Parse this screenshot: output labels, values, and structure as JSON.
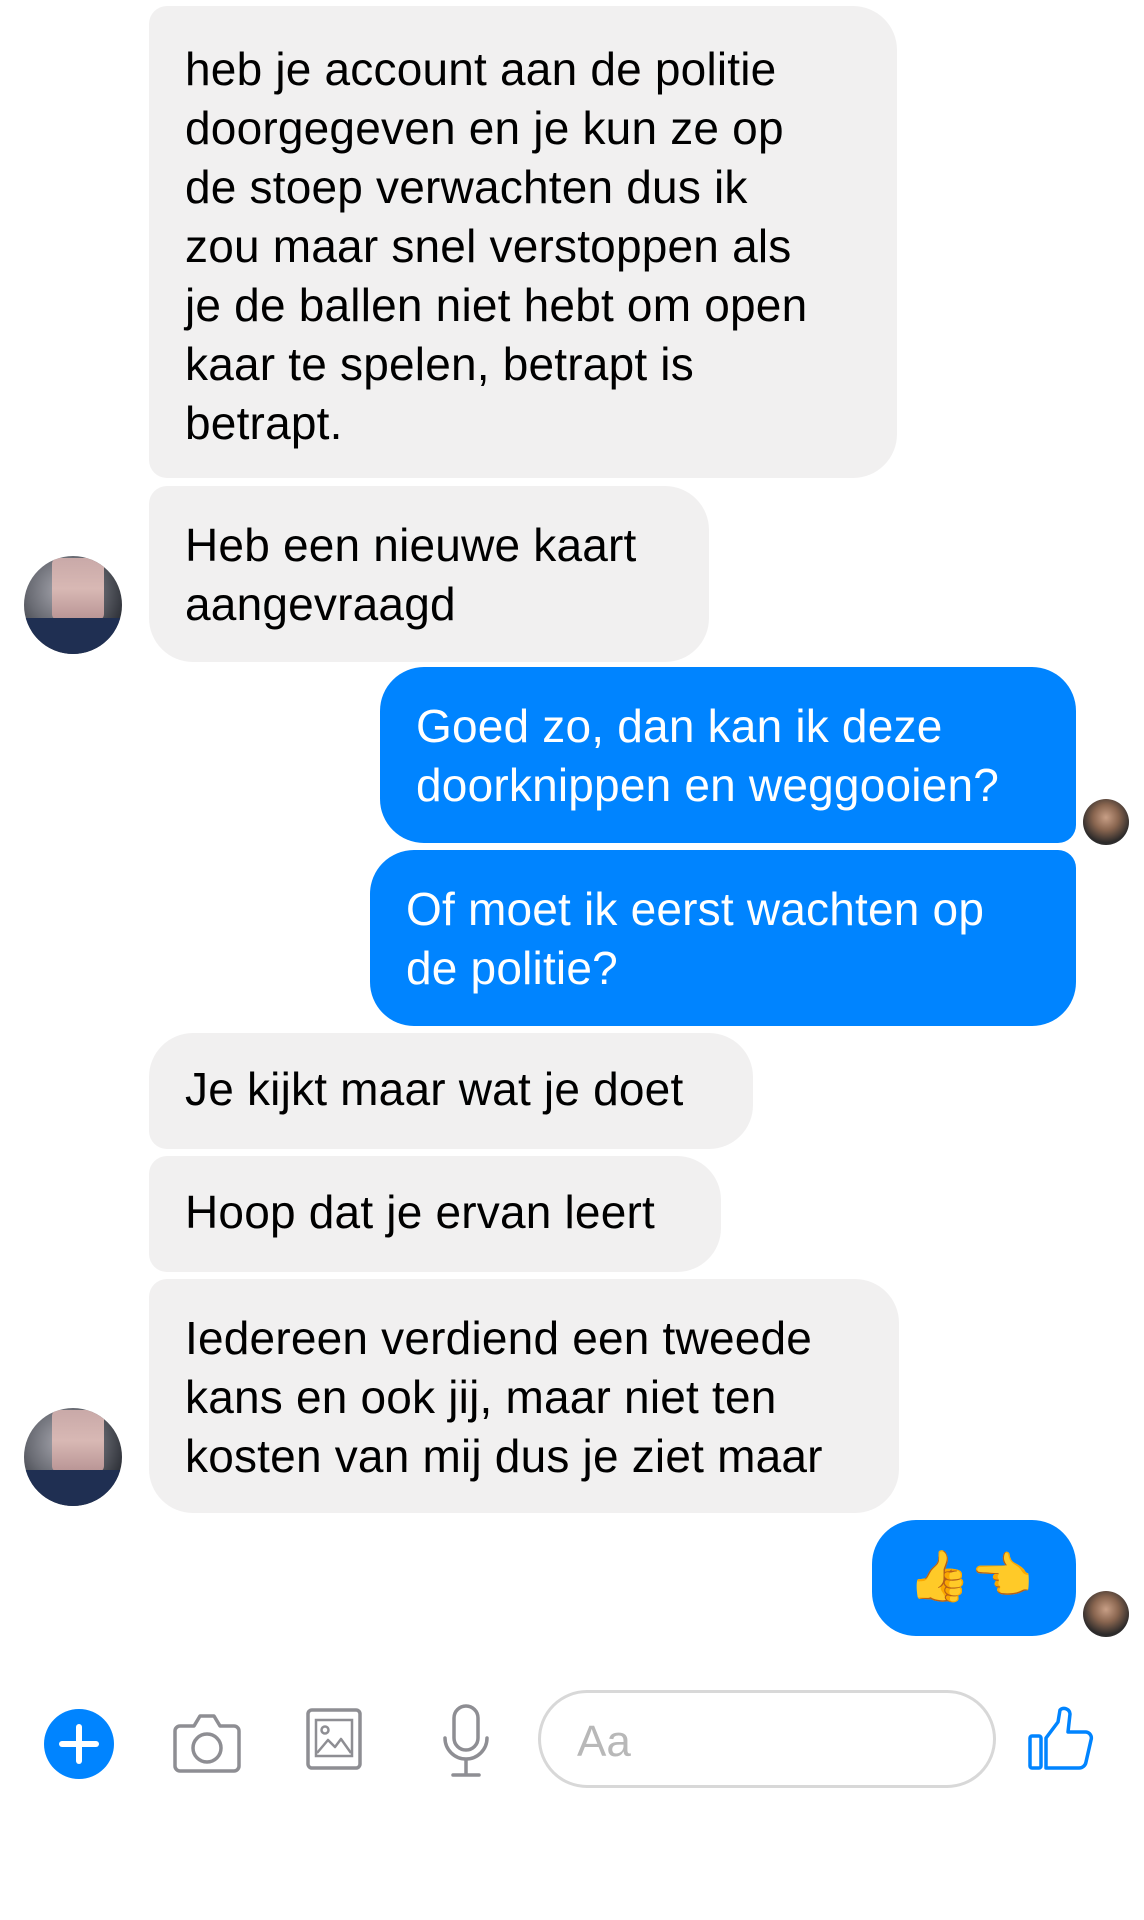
{
  "messages": [
    {
      "direction": "in",
      "text": "heb je account aan de politie\ndoorgegeven en je kun ze op\nde stoep verwachten dus ik\nzou maar snel verstoppen als\nje de ballen niet hebt om open\nkaar te spelen, betrapt is\nbetrapt."
    },
    {
      "direction": "in",
      "text": "Heb een nieuwe kaart\naangevraagd"
    },
    {
      "direction": "out",
      "text": "Goed zo, dan kan ik deze\ndoorknippen en weggooien?"
    },
    {
      "direction": "out",
      "text": "Of moet ik eerst wachten op\nde politie?"
    },
    {
      "direction": "in",
      "text": "Je kijkt maar wat je doet"
    },
    {
      "direction": "in",
      "text": "Hoop dat je ervan leert"
    },
    {
      "direction": "in",
      "text": "Iedereen verdiend een tweede\nkans en ook jij, maar niet ten\nkosten van mij dus je ziet maar"
    },
    {
      "direction": "out",
      "text": "👍👈"
    }
  ],
  "composer": {
    "placeholder": "Aa",
    "icons": [
      "plus-icon",
      "camera-icon",
      "image-icon",
      "microphone-icon",
      "thumbs-up-icon"
    ]
  },
  "colors": {
    "outgoing_bubble": "#0084ff",
    "incoming_bubble": "#f1f0f0",
    "accent": "#0084ff"
  }
}
